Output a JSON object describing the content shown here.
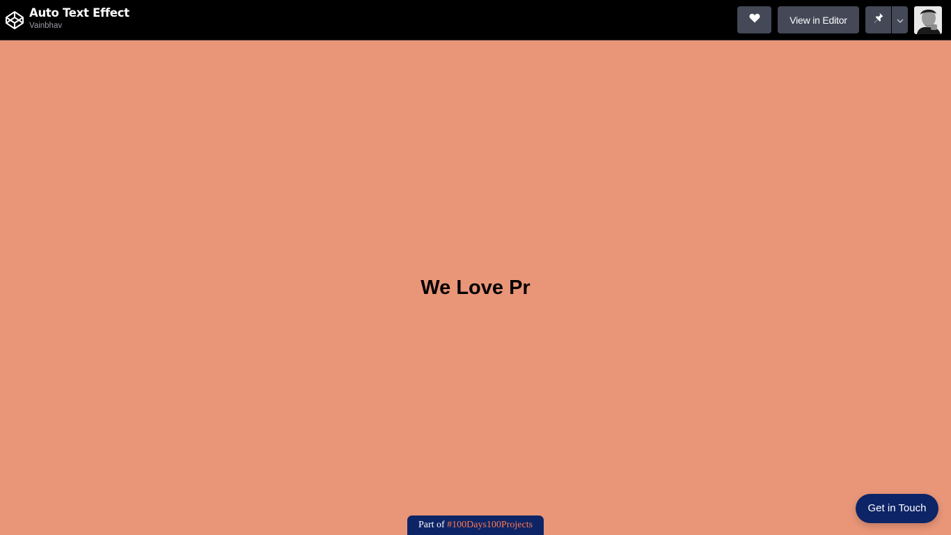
{
  "header": {
    "pen_title": "Auto Text Effect",
    "author": "Vainbhav",
    "view_in_editor_label": "View in Editor",
    "logo_icon": "codepen-logo-icon",
    "heart_icon": "heart-icon",
    "pin_icon": "pin-icon",
    "dropdown_icon": "chevron-down-icon"
  },
  "main": {
    "headline": "We Love Pr",
    "background_color": "#e99578"
  },
  "badge": {
    "prefix": "Part of",
    "tag": "#100Days100Projects"
  },
  "contact_button": {
    "label": "Get in Touch"
  },
  "colors": {
    "topbar": "#000000",
    "button": "#444857",
    "navy": "#0d2466",
    "tag_accent": "#ff7a4f"
  }
}
